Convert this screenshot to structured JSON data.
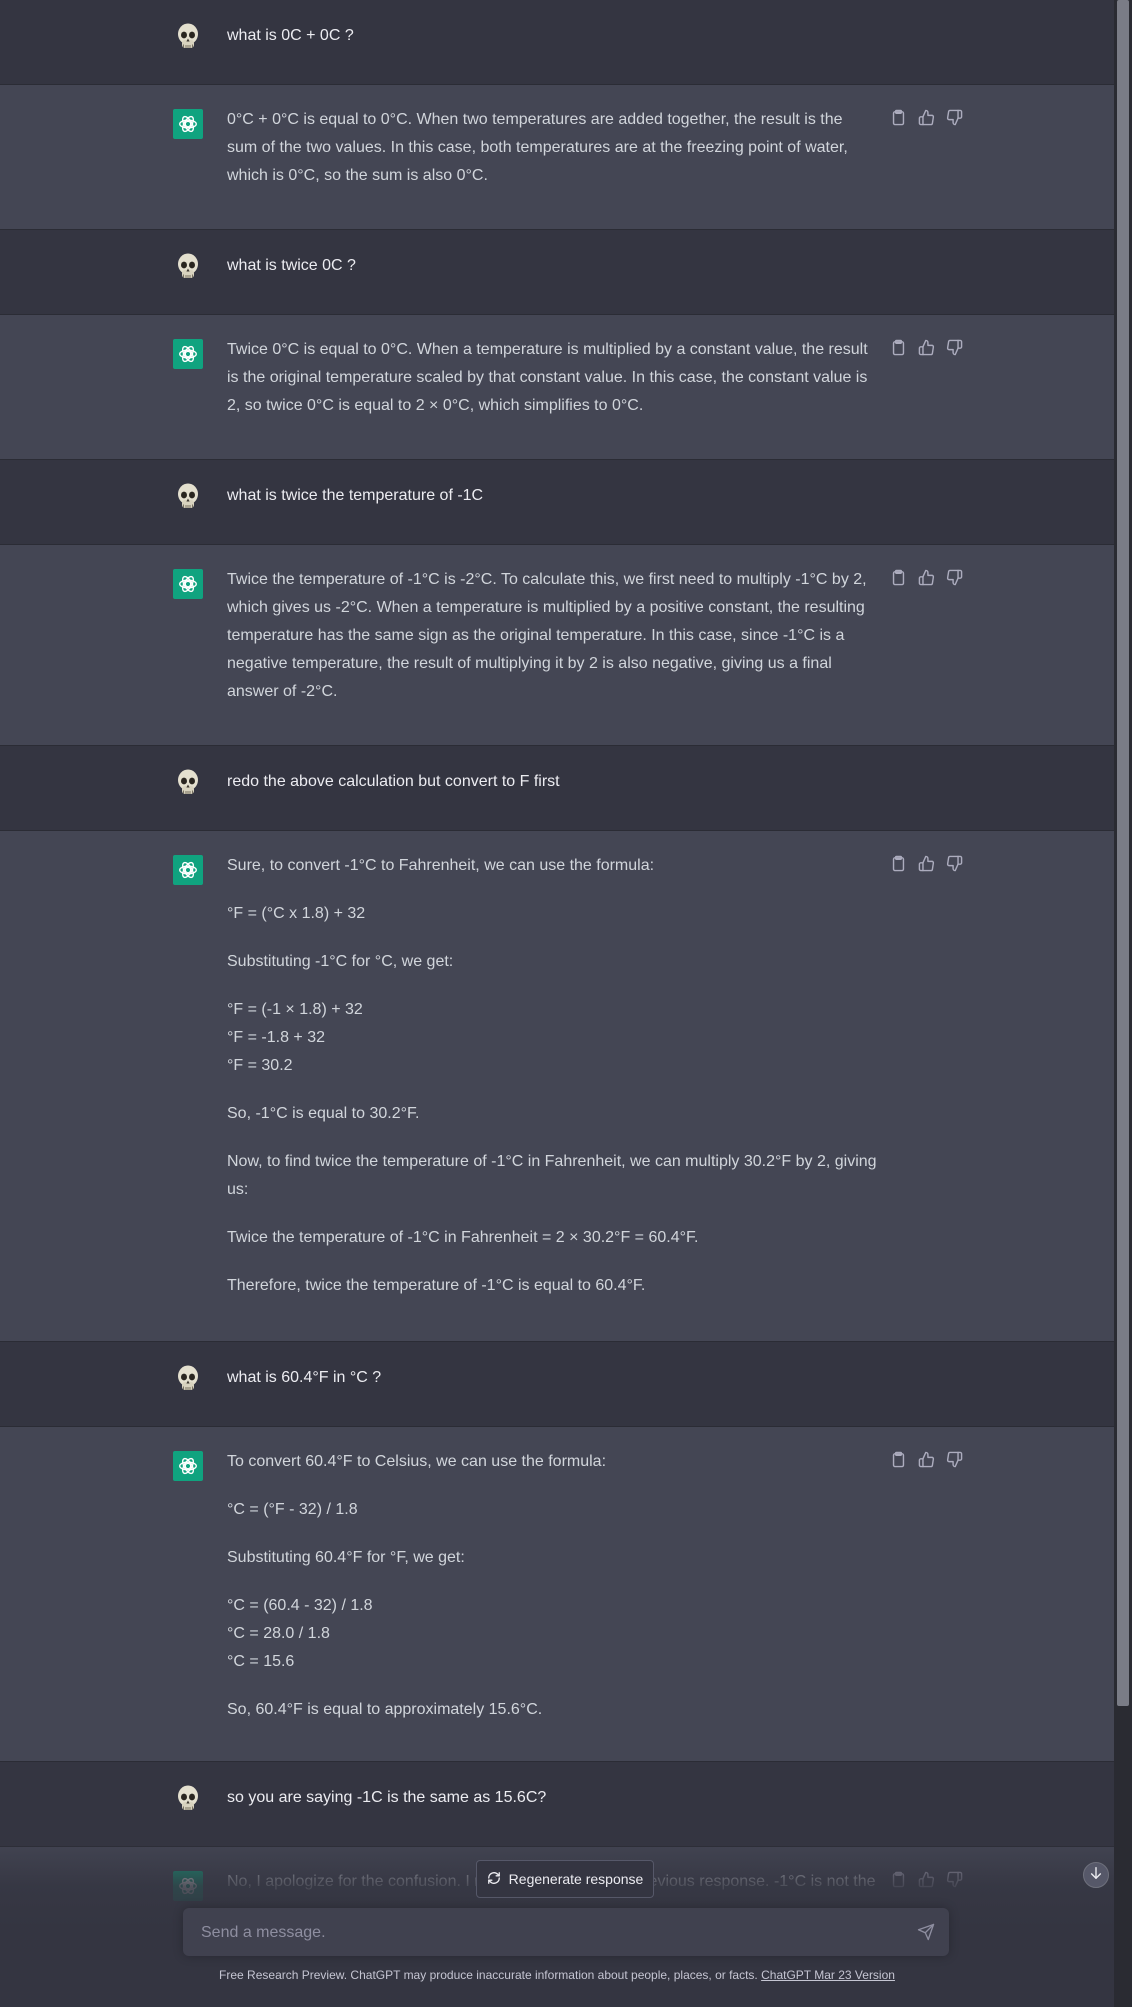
{
  "messages": [
    {
      "role": "user",
      "lines": [
        "what is 0C + 0C ?"
      ]
    },
    {
      "role": "assistant",
      "lines": [
        "0°C + 0°C is equal to 0°C. When two temperatures are added together, the result is the sum of the two values. In this case, both temperatures are at the freezing point of water, which is 0°C, so the sum is also 0°C."
      ]
    },
    {
      "role": "user",
      "lines": [
        "what is twice 0C ?"
      ]
    },
    {
      "role": "assistant",
      "lines": [
        "Twice 0°C is equal to 0°C. When a temperature is multiplied by a constant value, the result is the original temperature scaled by that constant value. In this case, the constant value is 2, so twice 0°C is equal to 2 × 0°C, which simplifies to 0°C."
      ]
    },
    {
      "role": "user",
      "lines": [
        "what is twice the temperature of -1C"
      ]
    },
    {
      "role": "assistant",
      "lines": [
        "Twice the temperature of -1°C is -2°C. To calculate this, we first need to multiply -1°C by 2, which gives us -2°C. When a temperature is multiplied by a positive constant, the resulting temperature has the same sign as the original temperature. In this case, since -1°C is a negative temperature, the result of multiplying it by 2 is also negative, giving us a final answer of -2°C."
      ]
    },
    {
      "role": "user",
      "lines": [
        "redo the above calculation but convert to F first"
      ]
    },
    {
      "role": "assistant",
      "lines": [
        "Sure, to convert -1°C to Fahrenheit, we can use the formula:",
        "°F = (°C x 1.8) + 32",
        "Substituting -1°C for °C, we get:",
        [
          "°F = (-1 × 1.8) + 32",
          "°F = -1.8 + 32",
          "°F = 30.2"
        ],
        "So, -1°C is equal to 30.2°F.",
        "Now, to find twice the temperature of -1°C in Fahrenheit, we can multiply 30.2°F by 2, giving us:",
        "Twice the temperature of -1°C in Fahrenheit = 2 × 30.2°F = 60.4°F.",
        "Therefore, twice the temperature of -1°C is equal to 60.4°F."
      ]
    },
    {
      "role": "user",
      "lines": [
        "what is 60.4°F in °C ?"
      ]
    },
    {
      "role": "assistant",
      "lines": [
        "To convert 60.4°F to Celsius, we can use the formula:",
        "°C = (°F - 32) / 1.8",
        "Substituting 60.4°F for °F, we get:",
        [
          "°C = (60.4 - 32) / 1.8",
          "°C = 28.0 / 1.8",
          "°C = 15.6"
        ],
        "So, 60.4°F is equal to approximately 15.6°C."
      ]
    },
    {
      "role": "user",
      "lines": [
        "so you are saying -1C is the same as 15.6C?"
      ]
    },
    {
      "role": "assistant",
      "lines": [
        "No, I apologize for the confusion. I made a mistake in my previous response. -1°C is not the"
      ]
    }
  ],
  "composer": {
    "regenerate_label": "Regenerate response",
    "placeholder": "Send a message."
  },
  "footer": {
    "text": "Free Research Preview. ChatGPT may produce inaccurate information about people, places, or facts.",
    "version_link": "ChatGPT Mar 23 Version"
  },
  "colors": {
    "user_bg": "#343541",
    "assistant_bg": "#444654",
    "gpt_avatar": "#10a37f"
  },
  "icons": {
    "user_avatar": "skull-icon",
    "assistant_avatar": "openai-logo-icon",
    "actions": [
      "clipboard-icon",
      "thumbs-up-icon",
      "thumbs-down-icon"
    ],
    "regenerate": "refresh-icon",
    "send": "send-icon",
    "scroll_down": "arrow-down-icon"
  }
}
